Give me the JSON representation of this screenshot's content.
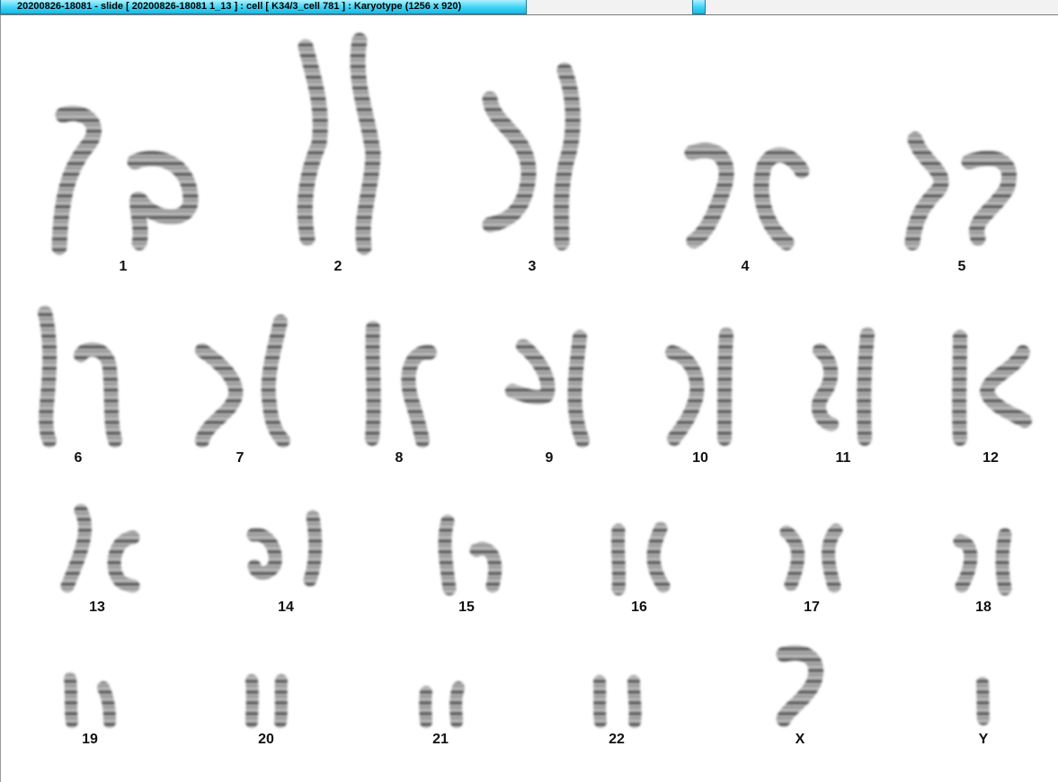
{
  "window": {
    "title": "20200826-18081 - slide [ 20200826-18081 1_13 ] : cell [ K34/3_cell 781 ] : Karyotype  (1256 x 920)"
  },
  "karyotype": {
    "labels": {
      "c1": "1",
      "c2": "2",
      "c3": "3",
      "c4": "4",
      "c5": "5",
      "c6": "6",
      "c7": "7",
      "c8": "8",
      "c9": "9",
      "c10": "10",
      "c11": "11",
      "c12": "12",
      "c13": "13",
      "c14": "14",
      "c15": "15",
      "c16": "16",
      "c17": "17",
      "c18": "18",
      "c19": "19",
      "c20": "20",
      "c21": "21",
      "c22": "22",
      "cX": "X",
      "cY": "Y"
    }
  }
}
